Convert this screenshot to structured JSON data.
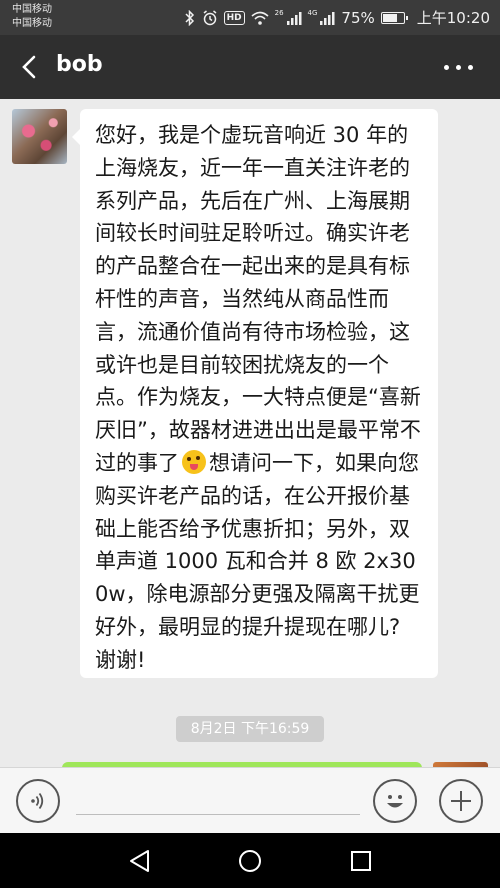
{
  "status_bar": {
    "carrier_1": "中国移动",
    "carrier_2": "中国移动",
    "hd_label": "HD",
    "net_label_1": "26",
    "net_label_2": "4G",
    "battery_percent": "75%",
    "battery_level": 0.75,
    "time": "上午10:20",
    "icons": [
      "bluetooth-icon",
      "alarm-icon",
      "wifi-icon",
      "signal-icon",
      "battery-icon"
    ]
  },
  "header": {
    "title": "bob",
    "back_icon": "back-chevron-icon",
    "more_icon": "more-icon"
  },
  "messages": [
    {
      "direction": "received",
      "text_before_emoji": "您好，我是个虚玩音响近 30 年的上海烧友，近一年一直关注许老的系列产品，先后在广州、上海展期间较长时间驻足聆听过。确实许老的产品整合在一起出来的是具有标杆性的声音，当然纯从商品性而言，流通价值尚有待市场检验，这或许也是目前较困扰烧友的一个点。作为烧友，一大特点便是“喜新厌旧”，故器材进进出出是最平常不过的事了",
      "emoji": "winking-tongue-emoji",
      "text_after_emoji": "想请问一下，如果向您购买许老产品的话，在公开报价基础上能否给予优惠折扣；另外，双单声道 1000 瓦和合并 8 欧 2x300w，除电源部分更强及隔离干扰更好外，最明显的提升提现在哪儿? 谢谢!"
    }
  ],
  "timestamp": "8月2日 下午16:59",
  "colors": {
    "status_bar_bg": "#3b3b3b",
    "header_bg": "#2f2f2f",
    "chat_bg": "#ebebeb",
    "received_bubble": "#ffffff",
    "sent_bubble": "#9fe65a",
    "timestamp_bg": "#cecece"
  },
  "input_bar": {
    "voice_icon": "voice-icon",
    "emoji_icon": "emoji-icon",
    "plus_icon": "plus-icon"
  },
  "nav_bar": {
    "icons": [
      "nav-back-icon",
      "nav-home-icon",
      "nav-recent-icon"
    ]
  }
}
